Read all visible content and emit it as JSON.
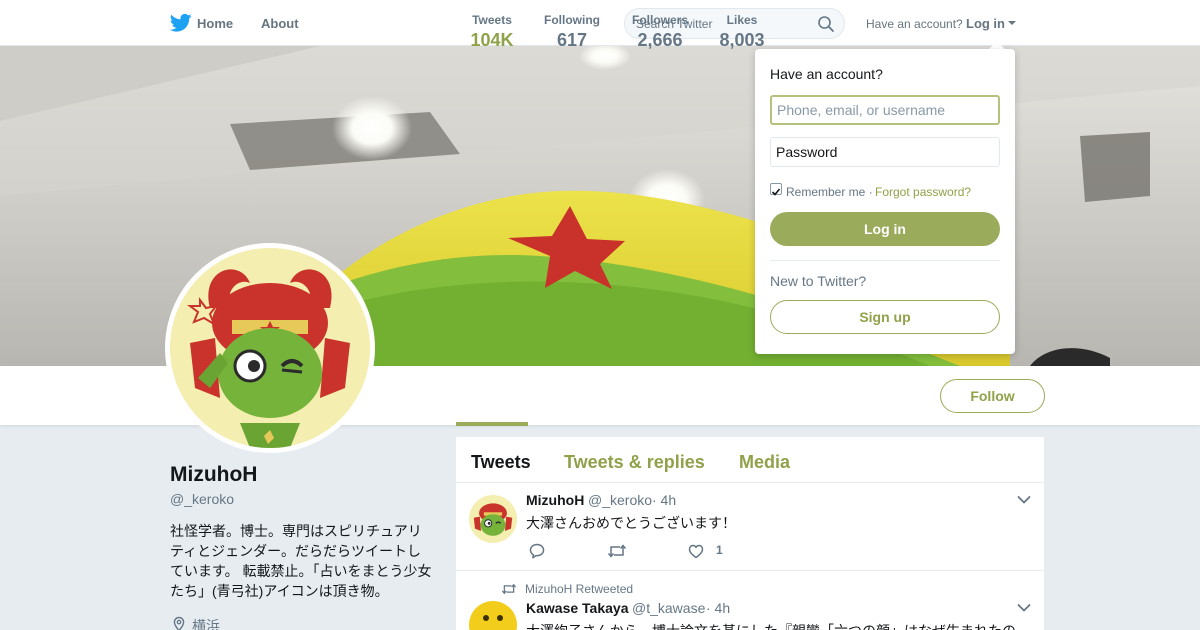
{
  "nav": {
    "home_label": "Home",
    "about_label": "About",
    "search_placeholder": "Search Twitter",
    "have_account": "Have an account?",
    "login_label": "Log in",
    "logo_icon": "twitter-bird-icon",
    "search_icon": "magnifier-icon"
  },
  "colors": {
    "accent": "#9aab5c",
    "accent_text": "#8fa24a",
    "twitter_blue": "#1da1f2",
    "muted": "#657786"
  },
  "profile": {
    "name": "MizuhoH",
    "handle": "@_keroko",
    "bio": "社怪学者。博士。専門はスピリチュアリティとジェンダー。だらだらツイートしています。 転載禁止。「占いをまとう少女たち」(青弓社)アイコンは頂き物。",
    "location": "横浜",
    "location_icon": "map-pin-icon"
  },
  "stats": [
    {
      "label": "Tweets",
      "value": "104K"
    },
    {
      "label": "Following",
      "value": "617"
    },
    {
      "label": "Followers",
      "value": "2,666"
    },
    {
      "label": "Likes",
      "value": "8,003"
    }
  ],
  "follow_label": "Follow",
  "tabs": [
    "Tweets",
    "Tweets & replies",
    "Media"
  ],
  "tweets": [
    {
      "name": "MizuhoH",
      "handle": "@_keroko",
      "time": "· 4h",
      "text": "大澤さんおめでとうございます！",
      "like_count": "1"
    },
    {
      "context": "MizuhoH Retweeted",
      "name": "Kawase Takaya",
      "handle": "@t_kawase",
      "time": "· 4h",
      "text": "大澤絢子さんから、博士論文を基にした『親鸞「六つの顔」はなぜ生まれたの"
    }
  ],
  "login_dropdown": {
    "title": "Have an account?",
    "username_placeholder": "Phone, email, or username",
    "password_placeholder": "Password",
    "remember_label": "Remember me ·",
    "remember_checked": true,
    "forgot_label": "Forgot password?",
    "login_button": "Log in",
    "new_label": "New to Twitter?",
    "signup_button": "Sign up"
  }
}
